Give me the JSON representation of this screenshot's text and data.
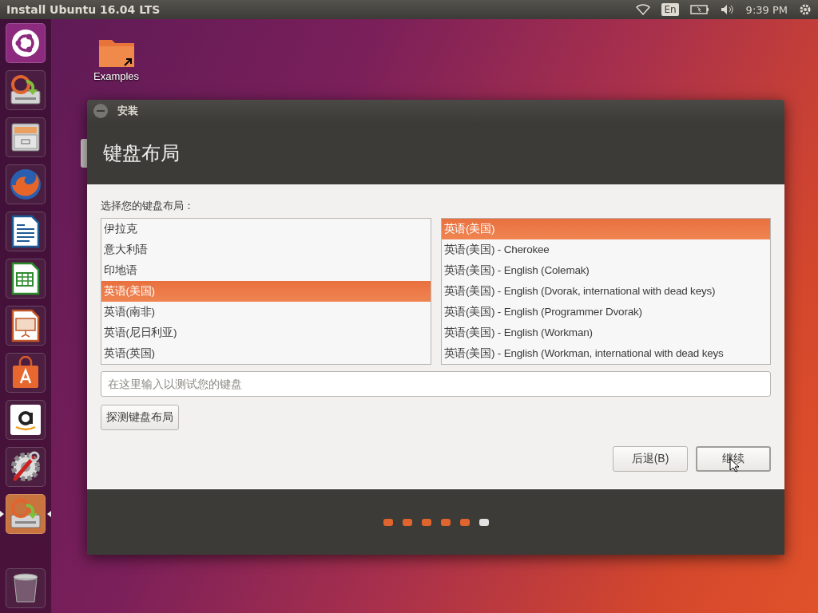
{
  "top_panel": {
    "title": "Install Ubuntu 16.04 LTS",
    "keyboard_indicator": "En",
    "clock": "9:39 PM"
  },
  "launcher": [
    {
      "kind": "dash",
      "focused": false
    },
    {
      "kind": "installer",
      "focused": false
    },
    {
      "kind": "files",
      "focused": false
    },
    {
      "kind": "firefox",
      "focused": false
    },
    {
      "kind": "writer",
      "focused": false
    },
    {
      "kind": "calc",
      "focused": false
    },
    {
      "kind": "impress",
      "focused": false
    },
    {
      "kind": "software",
      "focused": false
    },
    {
      "kind": "amazon",
      "focused": false
    },
    {
      "kind": "settings",
      "focused": false
    },
    {
      "kind": "installer",
      "focused": true
    },
    {
      "kind": "trash",
      "focused": false
    }
  ],
  "desktop_icons": [
    {
      "label": "Examples"
    }
  ],
  "window": {
    "title": "安装",
    "heading": "键盘布局",
    "prompt": "选择您的键盘布局：",
    "layouts": [
      {
        "label": "伊拉克",
        "selected": false
      },
      {
        "label": "意大利语",
        "selected": false
      },
      {
        "label": "印地语",
        "selected": false
      },
      {
        "label": "英语(美国)",
        "selected": true
      },
      {
        "label": "英语(南非)",
        "selected": false
      },
      {
        "label": "英语(尼日利亚)",
        "selected": false
      },
      {
        "label": "英语(英国)",
        "selected": false
      }
    ],
    "variants": [
      {
        "label": "英语(美国)",
        "selected": true
      },
      {
        "label": "英语(美国) - Cherokee",
        "selected": false
      },
      {
        "label": "英语(美国) - English (Colemak)",
        "selected": false
      },
      {
        "label": "英语(美国) - English (Dvorak, international with dead keys)",
        "selected": false
      },
      {
        "label": "英语(美国) - English (Programmer Dvorak)",
        "selected": false
      },
      {
        "label": "英语(美国) - English (Workman)",
        "selected": false
      },
      {
        "label": "英语(美国) - English (Workman, international with dead keys",
        "selected": false
      }
    ],
    "test_field": {
      "placeholder": "在这里输入以测试您的键盘"
    },
    "detect_button": "探测键盘布局",
    "buttons": [
      {
        "label": "后退(B)",
        "kind": "secondary"
      },
      {
        "label": "继续",
        "kind": "default"
      }
    ],
    "progress": [
      {
        "done": true
      },
      {
        "done": true
      },
      {
        "done": true
      },
      {
        "done": true
      },
      {
        "done": true
      },
      {
        "done": false
      }
    ]
  }
}
